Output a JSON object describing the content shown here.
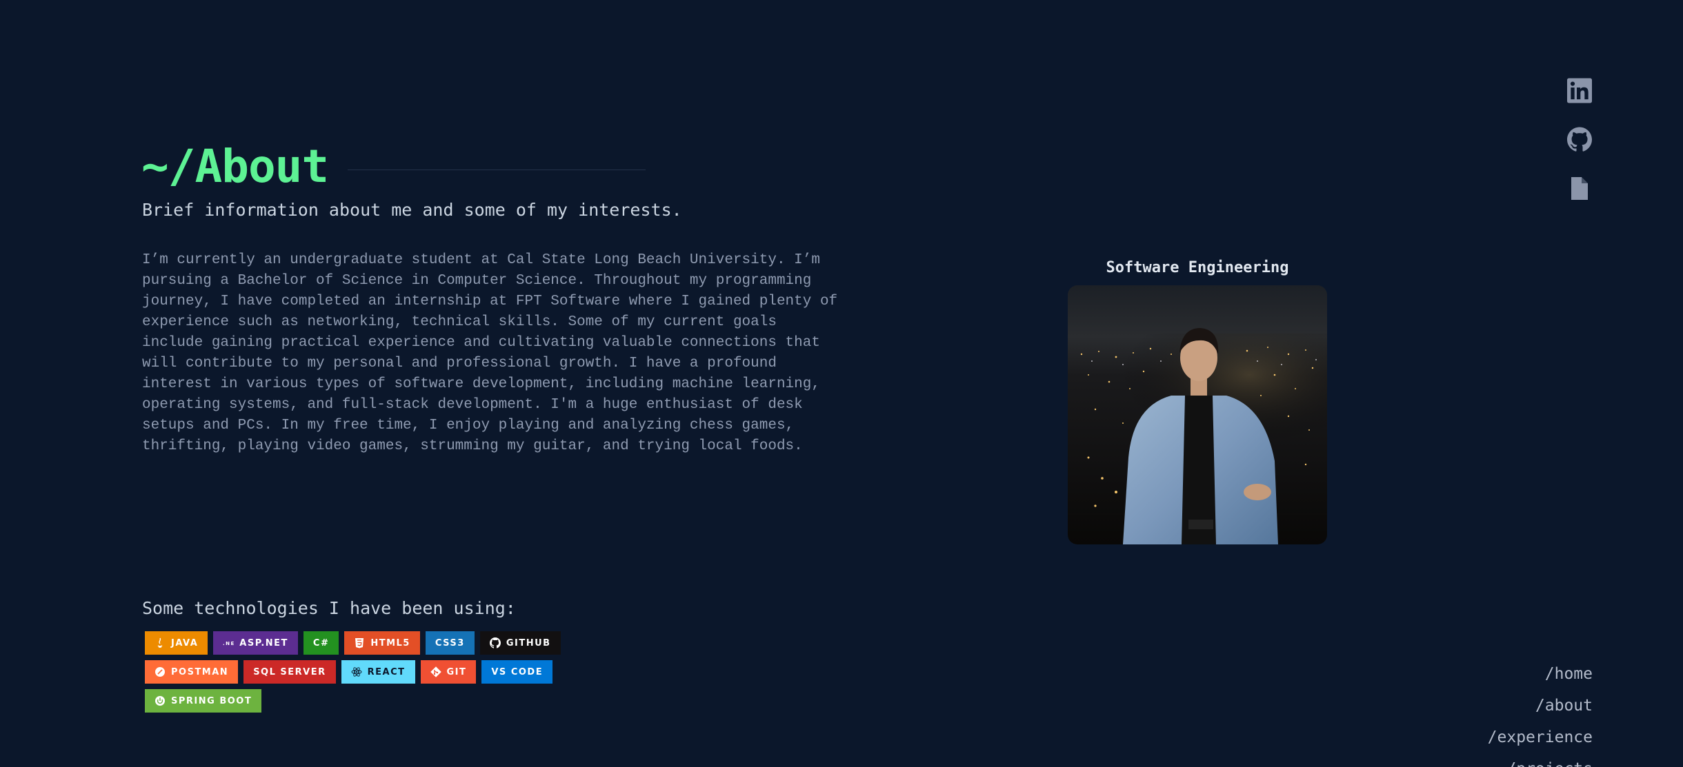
{
  "header": {
    "title": "~/About",
    "subtitle": "Brief information about me and some of my interests."
  },
  "bio": {
    "text": "I’m currently an undergraduate student at Cal State Long Beach University. I’m pursuing a Bachelor of Science in Computer Science. Throughout my programming journey, I have completed an internship at FPT Software where I gained plenty of experience such as networking, technical skills. Some of my current goals include gaining practical experience and cultivating valuable connections that will contribute to my personal and professional growth. I have a profound interest in various types of software development, including machine learning, operating systems, and full-stack development. I'm a huge enthusiast of desk setups and PCs. In my free time, I enjoy playing and analyzing chess games, thrifting, playing video games, strumming my guitar, and trying local foods."
  },
  "photo": {
    "caption": "Software Engineering"
  },
  "technologies": {
    "heading": "Some technologies I have been using:",
    "badges": [
      {
        "label": "JAVA",
        "color": "#ed8b00",
        "icon": "java-icon"
      },
      {
        "label": "ASP.NET",
        "color": "#5c2d91",
        "icon": "dotnet-icon"
      },
      {
        "label": "C#",
        "color": "#239120",
        "icon": ""
      },
      {
        "label": "HTML5",
        "color": "#e34f26",
        "icon": "html5-icon"
      },
      {
        "label": "CSS3",
        "color": "#1572b6",
        "icon": ""
      },
      {
        "label": "GITHUB",
        "color": "#121011",
        "icon": "github-icon"
      },
      {
        "label": "POSTMAN",
        "color": "#ff6c37",
        "icon": "postman-icon"
      },
      {
        "label": "SQL SERVER",
        "color": "#cc2927",
        "icon": ""
      },
      {
        "label": "REACT",
        "color": "#61dafb",
        "icon": "react-icon"
      },
      {
        "label": "GIT",
        "color": "#f05033",
        "icon": "git-icon"
      },
      {
        "label": "VS CODE",
        "color": "#0078d7",
        "icon": ""
      },
      {
        "label": "SPRING BOOT",
        "color": "#6db33f",
        "icon": "spring-icon"
      }
    ]
  },
  "social": [
    "linkedin-icon",
    "github-icon",
    "resume-icon"
  ],
  "nav": {
    "items": [
      "/home",
      "/about",
      "/experience",
      "/projects"
    ]
  }
}
